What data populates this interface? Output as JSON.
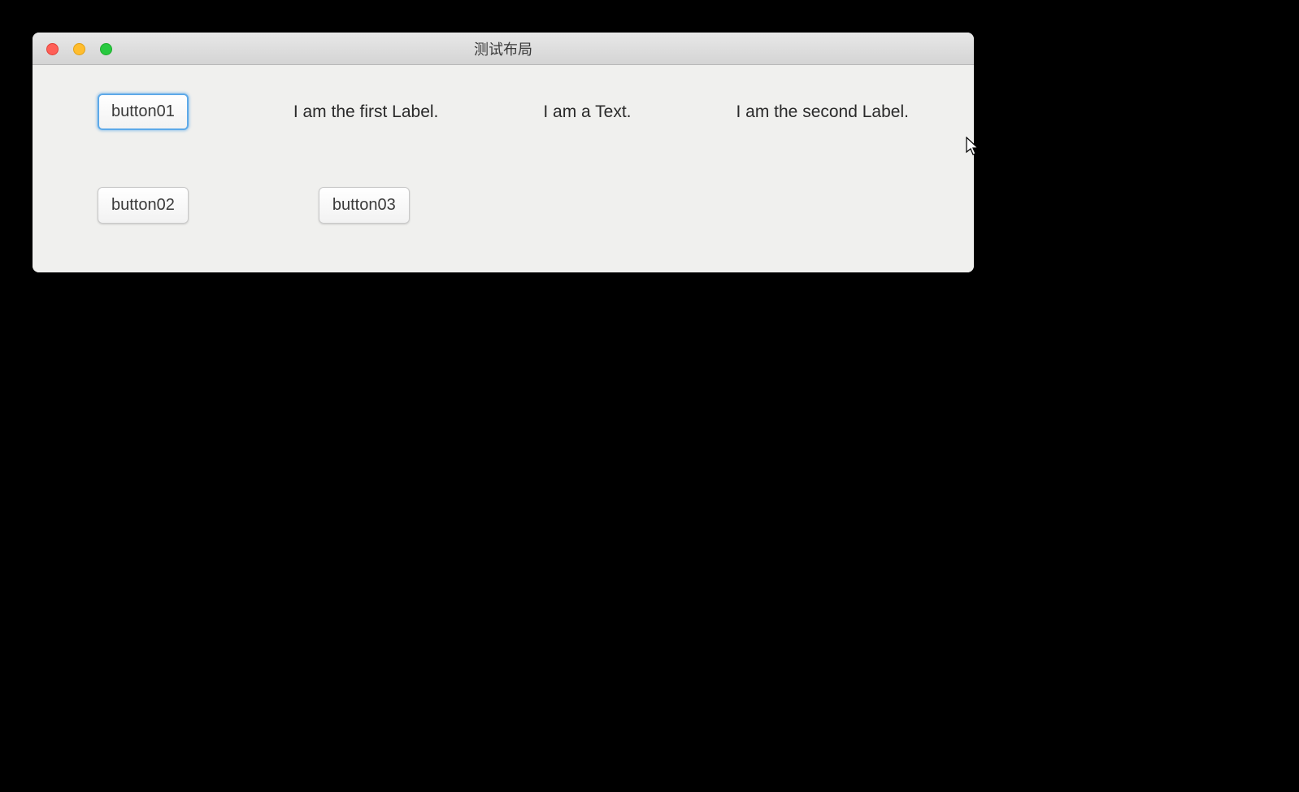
{
  "window": {
    "title": "测试布局"
  },
  "row1": {
    "button01": "button01",
    "label1": "I am the first Label.",
    "text1": "I am a Text.",
    "label2": "I am the second Label."
  },
  "row2": {
    "button02": "button02",
    "button03": "button03"
  }
}
